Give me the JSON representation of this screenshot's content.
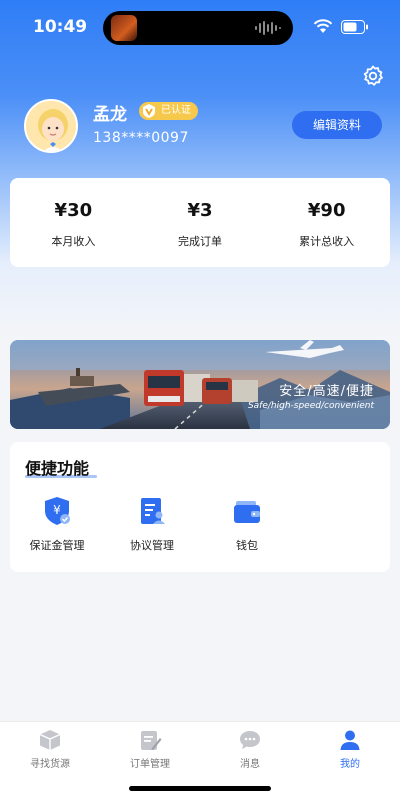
{
  "status_bar": {
    "time": "10:49"
  },
  "profile": {
    "name": "孟龙",
    "verified_label": "已认证",
    "phone": "138****0097",
    "edit_button": "编辑资料"
  },
  "stats": [
    {
      "value": "¥30",
      "label": "本月收入"
    },
    {
      "value": "¥3",
      "label": "完成订单"
    },
    {
      "value": "¥90",
      "label": "累计总收入"
    }
  ],
  "banner": {
    "title": "安全/高速/便捷",
    "subtitle": "Safe/high-speed/convenient"
  },
  "quick_actions": {
    "title": "便捷功能",
    "items": [
      {
        "label": "保证金管理",
        "icon": "deposit-shield-icon"
      },
      {
        "label": "协议管理",
        "icon": "agreement-icon"
      },
      {
        "label": "钱包",
        "icon": "wallet-icon"
      }
    ]
  },
  "tabbar": {
    "items": [
      {
        "label": "寻找货源",
        "icon": "box-icon",
        "active": false
      },
      {
        "label": "订单管理",
        "icon": "order-edit-icon",
        "active": false
      },
      {
        "label": "消息",
        "icon": "message-icon",
        "active": false
      },
      {
        "label": "我的",
        "icon": "profile-icon",
        "active": true
      }
    ]
  },
  "colors": {
    "primary": "#2f6ef0",
    "header_top": "#2f7df6",
    "badge": "#f6c84b",
    "background": "#f4f5f8"
  }
}
